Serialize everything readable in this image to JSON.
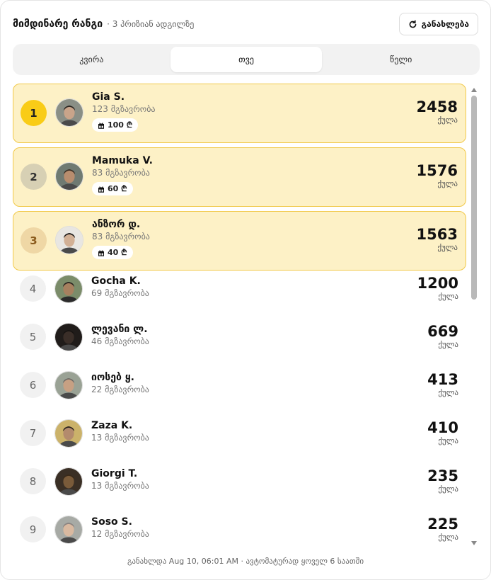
{
  "header": {
    "title": "მიმდინარე რანგი",
    "subtitle": "· 3 პრიზიან ადგილზე",
    "refresh_label": "განახლება"
  },
  "tabs": [
    {
      "label": "კვირა",
      "active": false
    },
    {
      "label": "თვე",
      "active": true
    },
    {
      "label": "წელი",
      "active": false
    }
  ],
  "leaderboard": [
    {
      "rank": "1",
      "name": "Gia S.",
      "trips": "123 მგზავრობა",
      "prize": "100 ₾",
      "points": "2458",
      "points_label": "ქულა"
    },
    {
      "rank": "2",
      "name": "Mamuka V.",
      "trips": "83 მგზავრობა",
      "prize": "60 ₾",
      "points": "1576",
      "points_label": "ქულა"
    },
    {
      "rank": "3",
      "name": "ანზორ დ.",
      "trips": "83 მგზავრობა",
      "prize": "40 ₾",
      "points": "1563",
      "points_label": "ქულა"
    },
    {
      "rank": "4",
      "name": "Gocha K.",
      "trips": "69 მგზავრობა",
      "points": "1200",
      "points_label": "ქულა"
    },
    {
      "rank": "5",
      "name": "ლევანი ლ.",
      "trips": "46 მგზავრობა",
      "points": "669",
      "points_label": "ქულა"
    },
    {
      "rank": "6",
      "name": "იოსებ ყ.",
      "trips": "22 მგზავრობა",
      "points": "413",
      "points_label": "ქულა"
    },
    {
      "rank": "7",
      "name": "Zaza K.",
      "trips": "13 მგზავრობა",
      "points": "410",
      "points_label": "ქულა"
    },
    {
      "rank": "8",
      "name": "Giorgi T.",
      "trips": "13 მგზავრობა",
      "points": "235",
      "points_label": "ქულა"
    },
    {
      "rank": "9",
      "name": "Soso S.",
      "trips": "12 მგზავრობა",
      "points": "225",
      "points_label": "ქულა"
    }
  ],
  "footer": {
    "text": "განახლდა Aug 10, 06:01 AM · ავტომატურად ყოველ 6 საათში"
  },
  "colors": {
    "highlight_bg": "#fdf1c6",
    "highlight_border": "#f1c94a",
    "gold": "#f9cc17",
    "silver": "#d7d0b4",
    "bronze": "#efd7a5"
  },
  "icons": {
    "refresh": "refresh-icon",
    "prize": "gift-icon",
    "avatar": "user-photo"
  }
}
